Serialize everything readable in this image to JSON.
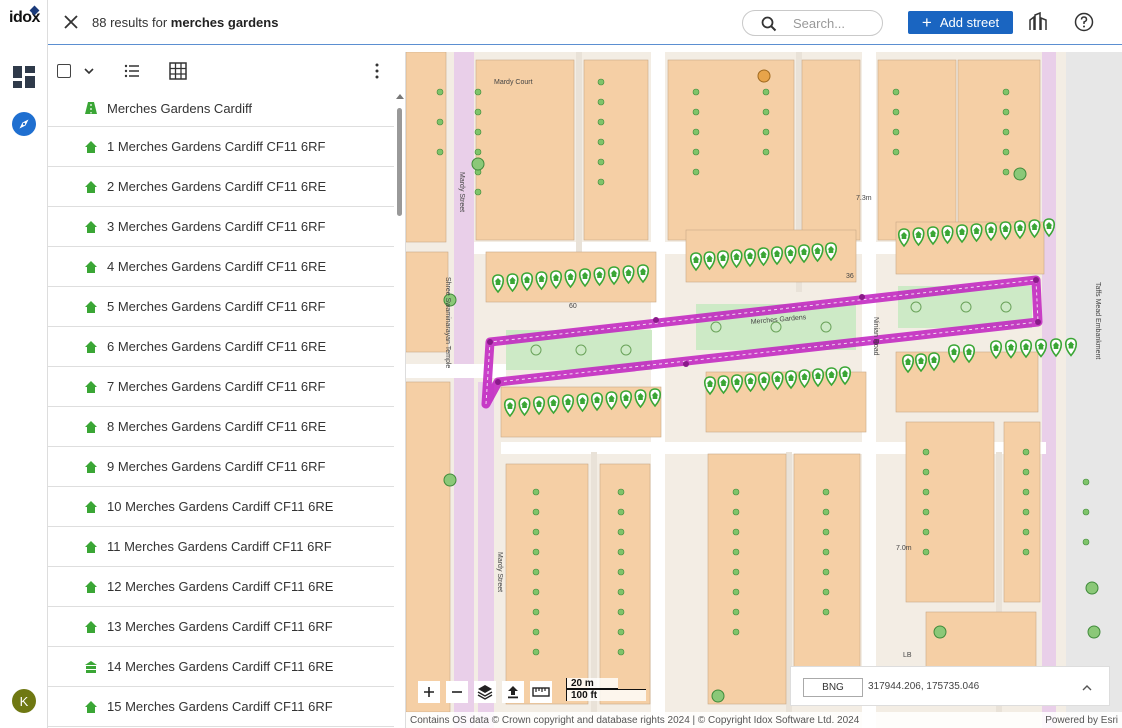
{
  "app": {
    "logo_text": "idox"
  },
  "header": {
    "results_prefix": "88 results for",
    "results_query": "merches gardens",
    "search_placeholder": "Search...",
    "add_street_label": "Add street"
  },
  "rail": {
    "avatar_initial": "K"
  },
  "results": [
    {
      "label": "Merches Gardens Cardiff",
      "icon": "street-icon"
    },
    {
      "label": "1 Merches Gardens Cardiff CF11 6RF",
      "icon": "house-icon"
    },
    {
      "label": "2 Merches Gardens Cardiff CF11 6RE",
      "icon": "house-icon"
    },
    {
      "label": "3 Merches Gardens Cardiff CF11 6RF",
      "icon": "house-icon"
    },
    {
      "label": "4 Merches Gardens Cardiff CF11 6RE",
      "icon": "house-icon"
    },
    {
      "label": "5 Merches Gardens Cardiff CF11 6RF",
      "icon": "house-icon"
    },
    {
      "label": "6 Merches Gardens Cardiff CF11 6RE",
      "icon": "house-icon"
    },
    {
      "label": "7 Merches Gardens Cardiff CF11 6RF",
      "icon": "house-icon"
    },
    {
      "label": "8 Merches Gardens Cardiff CF11 6RE",
      "icon": "house-icon"
    },
    {
      "label": "9 Merches Gardens Cardiff CF11 6RF",
      "icon": "house-icon"
    },
    {
      "label": "10 Merches Gardens Cardiff CF11 6RE",
      "icon": "house-icon"
    },
    {
      "label": "11 Merches Gardens Cardiff CF11 6RF",
      "icon": "house-icon"
    },
    {
      "label": "12 Merches Gardens Cardiff CF11 6RE",
      "icon": "house-icon"
    },
    {
      "label": "13 Merches Gardens Cardiff CF11 6RF",
      "icon": "house-icon"
    },
    {
      "label": "14 Merches Gardens Cardiff CF11 6RE",
      "icon": "flats-icon"
    },
    {
      "label": "15 Merches Gardens Cardiff CF11 6RF",
      "icon": "house-icon"
    }
  ],
  "map": {
    "labels": {
      "mardy_court": "Mardy Court",
      "mardy_street": "Mardy Street",
      "merches_gardens": "Merches Gardens",
      "taffs_mead": "Taffs Mead Embankment",
      "shree": "Shree Swaminarayan Temple",
      "ninian": "Ninian Road",
      "ht1": "7.3m",
      "ht2": "7.0m",
      "ht3": "6.8m",
      "lb": "LB",
      "num60": "60",
      "num36": "36",
      "num2": "2",
      "num18": "18"
    },
    "scale_metric": "20 m",
    "scale_imperial": "100 ft",
    "crs": "BNG",
    "coordinates": "317944.206, 175735.046",
    "attribution_left": "Contains OS data © Crown copyright and database rights 2024 | © Copyright Idox Software Ltd. 2024",
    "attribution_right": "Powered by Esri",
    "colors": {
      "highlight": "#c01fc0",
      "pin": "#3aa635",
      "building": "#f5cfa5",
      "road_pink": "#e7c9ea",
      "park": "#cdeac6"
    }
  }
}
